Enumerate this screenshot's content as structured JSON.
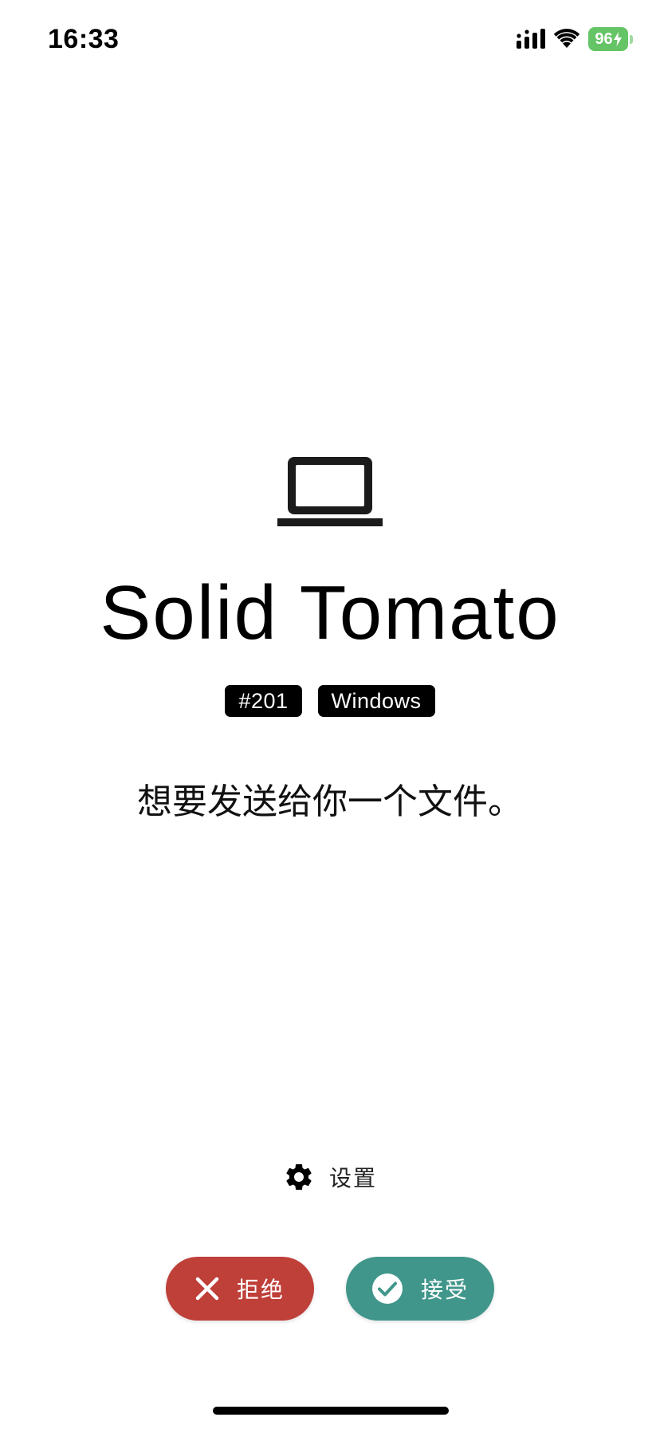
{
  "status_bar": {
    "time": "16:33",
    "battery_level": "96",
    "signal_icon": "cellular-signal-icon",
    "wifi_icon": "wifi-icon",
    "battery_icon": "battery-charging-icon",
    "battery_color": "#65c466"
  },
  "sender": {
    "device_icon": "laptop-icon",
    "name": "Solid Tomato",
    "tags": [
      "#201",
      "Windows"
    ],
    "message": "想要发送给你一个文件。"
  },
  "settings": {
    "icon": "gear-icon",
    "label": "设置"
  },
  "actions": {
    "decline": {
      "icon": "close-icon",
      "label": "拒绝",
      "color": "#bf3f39"
    },
    "accept": {
      "icon": "check-circle-icon",
      "label": "接受",
      "color": "#40968a"
    }
  }
}
